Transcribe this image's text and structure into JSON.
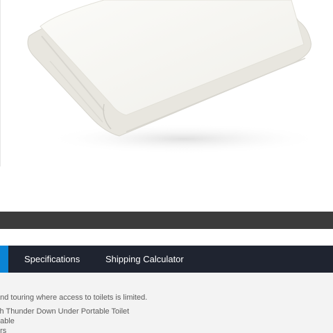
{
  "product_image": {
    "alt": "Folded white bag"
  },
  "tabs": [
    {
      "label": "Specifications"
    },
    {
      "label": "Shipping Calculator"
    }
  ],
  "description": {
    "text": "and touring where access to toilets is limited.",
    "features": [
      "ith Thunder Down Under Portable Toilet",
      "dable",
      "ers"
    ]
  },
  "colors": {
    "tab_bar": "#1f2430",
    "active_tab_indicator": "#0a84d6",
    "dark_bar": "#3b3b3b",
    "content_bg": "#f3f3f3"
  }
}
